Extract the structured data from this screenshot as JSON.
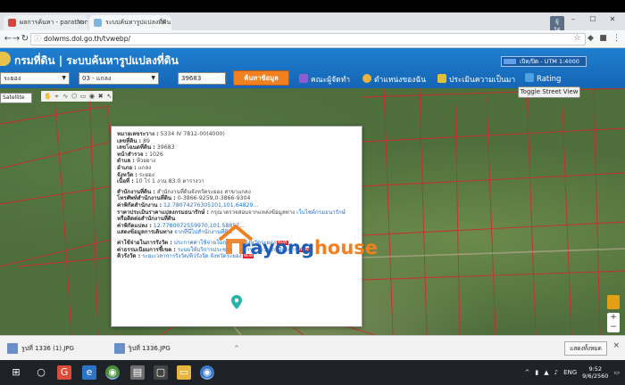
{
  "browser": {
    "tabs": [
      {
        "label": "ผลการค้นหา - parathank - Gmail",
        "icon": "gmail-icon",
        "active": false
      },
      {
        "label": "ระบบค้นหารูปแปลงที่ดิน",
        "icon": "web-icon",
        "active": true
      }
    ],
    "badge": "ผู้ใช้งานใหม่",
    "url": "dolwms.dol.go.th/tvwebp/"
  },
  "site": {
    "title": "กรมที่ดิน | ระบบค้นหารูปแปลงที่ดิน",
    "utm_toggle": "เปิด/ปิด - UTM 1:4000",
    "province_select": "ระยอง",
    "district_select": "03 - แกลง",
    "parcel_input": "39683",
    "search_button": "ค้นหาข้อมูล",
    "links": {
      "developers": "คณะผู้จัดทำ",
      "my_location": "ตำแหน่งของฉัน",
      "evaluation": "ประเมินความเป็นมา",
      "rating": "Rating"
    }
  },
  "map": {
    "layer_select": "Satellite",
    "street_view_button": "Toggle Street View",
    "subtext": "ระ",
    "watermark": {
      "rayong": "rayong",
      "house": "house"
    },
    "popup": {
      "rows": [
        {
          "label": "หมายเลขระวาง :",
          "value": "5334 IV 7812-00(4000)"
        },
        {
          "label": "เลขที่ดิน :",
          "value": "89"
        },
        {
          "label": "เลขโฉนดที่ดิน :",
          "value": "39683"
        },
        {
          "label": "หน้าสำรวจ :",
          "value": "1026"
        },
        {
          "label": "ตำบล :",
          "value": "ห้วยยาง"
        },
        {
          "label": "อำเภอ :",
          "value": "แกลง"
        },
        {
          "label": "จังหวัด :",
          "value": "ระยอง"
        },
        {
          "label": "เนื้อที่ :",
          "value": "10 ไร่ 1 งาน 83.0 ตารางวา"
        },
        {
          "label": "สำนักงานที่ดิน :",
          "value": "สำนักงานที่ดินจังหวัดระยอง สาขาแกลง"
        },
        {
          "label": "โทรศัพท์สำนักงานที่ดิน :",
          "value": "0-3866-9259,0-3866-9304"
        },
        {
          "label": "ค่าพิกัดสำนักงาน :",
          "value": "12.78074276305101,101.64829..."
        },
        {
          "label": "ราคาประเมินราคาแปลงกรมธนารักษ์ :",
          "value": "กรุณาตรวจสอบจากแหล่งข้อมูลทาง",
          "link": "เว็บไซต์กรมธนารักษ์"
        },
        {
          "label": "หรือติดต่อสำนักงานที่ดิน",
          "value": ""
        },
        {
          "label": "ค่าพิกัดแปลง :",
          "value": "12.7780072559970,101.58857..."
        },
        {
          "label": "แสดงข้อมูลการเดินทาง",
          "value": "",
          "link": "จากที่นี่ไปสำนักงานที่ดิน"
        }
      ],
      "fees": [
        {
          "label": "ค่าใช้จ่ายในการรังวัด :",
          "link": "ประกาศค่าใช้จ่ายในการรังวัดจังหวัดระยอง"
        },
        {
          "label": "ค่าธรรมเนียมการชี้เขต :",
          "link": "ระบบให้บริการประชาชนในการคำนวณภาษีอาการ"
        },
        {
          "label": "คิวรังวัด :",
          "link": "ระยะเวลาการรังวัด/คิวรังวัด จังหวัดระยอง"
        }
      ],
      "new_badge": "NEW"
    }
  },
  "downloads": {
    "items": [
      "รูปที่ 1336 (1).JPG",
      "รูปที่ 1336.JPG"
    ],
    "show_all": "แสดงทั้งหมด"
  },
  "taskbar": {
    "lang": "ENG",
    "time": "9:52",
    "date": "9/6/2560"
  }
}
